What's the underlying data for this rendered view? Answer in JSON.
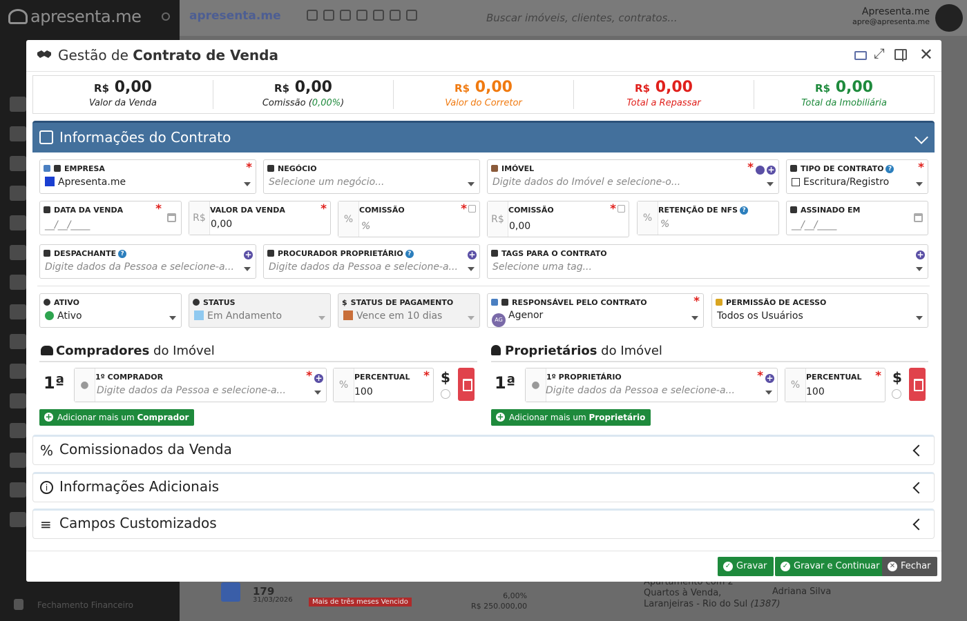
{
  "background": {
    "sidebar_logo": "apresenta.me",
    "top_logo": "apresenta.me",
    "search_placeholder": "Buscar imóveis, clientes, contratos...",
    "user_name": "Apresenta.me",
    "user_email": "apre@apresenta.me",
    "footer_link": "Fechamento Financeiro",
    "list_row": {
      "number": "179",
      "date": "31/03/2026",
      "status_badge": "Mais de três meses Vencido",
      "value_line1": "6,00%",
      "value_line2": "R$ 250.000,00",
      "description_line1": "Apartamento com 2",
      "description_line2": "Quartos à Venda,",
      "description_line3": "Laranjeiras - Rio do Sul",
      "description_code": "(1387)",
      "agent": "Adriana Silva"
    }
  },
  "modal": {
    "title_prefix": "Gestão de ",
    "title_bold": "Contrato de Venda",
    "summary": [
      {
        "currency": "R$",
        "value": "0,00",
        "label": "Valor da Venda",
        "color": "#222222"
      },
      {
        "currency": "R$",
        "value": "0,00",
        "label_prefix": "Comissão (",
        "label_pct": "0,00%",
        "label_suffix": ")",
        "color": "#222222"
      },
      {
        "currency": "R$",
        "value": "0,00",
        "label": "Valor do Corretor",
        "color": "#f07a10"
      },
      {
        "currency": "R$",
        "value": "0,00",
        "label": "Total a Repassar",
        "color": "#e0201c"
      },
      {
        "currency": "R$",
        "value": "0,00",
        "label": "Total da Imobiliária",
        "color": "#1e8a3c"
      }
    ],
    "section_title": "Informações do Contrato",
    "fields": {
      "empresa": {
        "label": "EMPRESA",
        "value": "Apresenta.me"
      },
      "negocio": {
        "label": "NEGÓCIO",
        "placeholder": "Selecione um negócio..."
      },
      "imovel": {
        "label": "IMÓVEL",
        "placeholder": "Digite dados do Imóvel e selecione-o..."
      },
      "tipo_contrato": {
        "label": "TIPO DE CONTRATO",
        "value": "Escritura/Registro"
      },
      "data_venda": {
        "label": "DATA DA VENDA",
        "placeholder": "__/__/____"
      },
      "valor_venda": {
        "label": "VALOR DA VENDA",
        "prefix": "R$",
        "value": "0,00"
      },
      "comissao_pct": {
        "label": "COMISSÃO",
        "prefix": "%",
        "placeholder": "%"
      },
      "comissao_val": {
        "label": "COMISSÃO",
        "prefix": "R$",
        "value": "0,00"
      },
      "retencao_nfs": {
        "label": "RETENÇÃO DE NFS",
        "prefix": "%",
        "placeholder": "%"
      },
      "assinado_em": {
        "label": "ASSINADO EM",
        "placeholder": "__/__/____"
      },
      "despachante": {
        "label": "DESPACHANTE",
        "placeholder": "Digite dados da Pessoa e selecione-a..."
      },
      "procurador": {
        "label": "PROCURADOR PROPRIETÁRIO",
        "placeholder": "Digite dados da Pessoa e selecione-a..."
      },
      "tags": {
        "label": "TAGS PARA O CONTRATO",
        "placeholder": "Selecione uma tag..."
      },
      "ativo": {
        "label": "ATIVO",
        "value": "Ativo"
      },
      "status": {
        "label": "STATUS",
        "value": "Em Andamento"
      },
      "status_pagamento": {
        "label": "STATUS DE PAGAMENTO",
        "value": "Vence em 10 dias"
      },
      "responsavel": {
        "label": "RESPONSÁVEL PELO CONTRATO",
        "value": "Agenor",
        "avatar": "AG"
      },
      "permissao": {
        "label": "PERMISSÃO DE ACESSO",
        "value": "Todos os Usuários"
      }
    },
    "compradores": {
      "title_bold": "Compradores",
      "title_rest": " do Imóvel",
      "ordinal": "1ª",
      "person_label": "1º COMPRADOR",
      "person_placeholder": "Digite dados da Pessoa e selecione-a...",
      "pct_label": "PERCENTUAL",
      "pct_prefix": "%",
      "pct_value": "100",
      "dollar": "$",
      "add_prefix": "Adicionar mais um ",
      "add_bold": "Comprador"
    },
    "proprietarios": {
      "title_bold": "Proprietários",
      "title_rest": " do Imóvel",
      "ordinal": "1ª",
      "person_label": "1º PROPRIETÁRIO",
      "person_placeholder": "Digite dados da Pessoa e selecione-a...",
      "pct_label": "PERCENTUAL",
      "pct_prefix": "%",
      "pct_value": "100",
      "dollar": "$",
      "add_prefix": "Adicionar mais um ",
      "add_bold": "Proprietário"
    },
    "panels": [
      {
        "title": "Comissionados da Venda",
        "icon": "percent-icon"
      },
      {
        "title": "Informações Adicionais",
        "icon": "info-circle-icon"
      },
      {
        "title": "Campos Customizados",
        "icon": "list-add-icon"
      }
    ],
    "buttons": {
      "save": "Gravar",
      "save_continue": "Gravar e Continuar",
      "close": "Fechar"
    }
  }
}
